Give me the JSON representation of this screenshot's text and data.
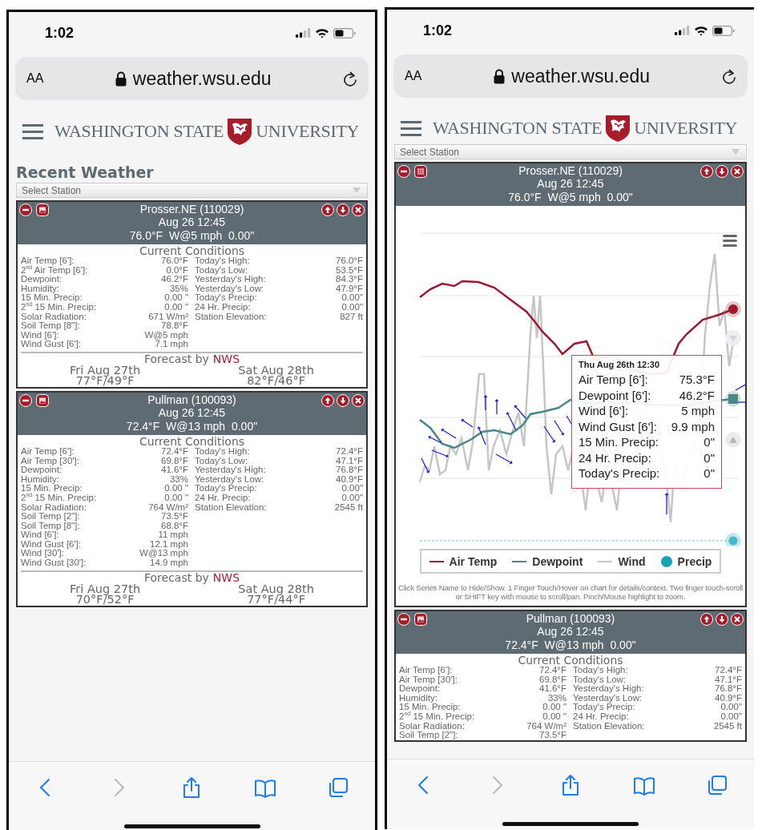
{
  "phones": [
    {
      "status": {
        "time": "1:02"
      },
      "address_bar": {
        "text_size_button": "AA",
        "url": "weather.wsu.edu"
      },
      "site_header": {
        "logo_left": "WASHINGTON STATE",
        "logo_right": "UNIVERSITY"
      },
      "page_title": "Recent Weather",
      "station_select": {
        "placeholder": "Select Station"
      },
      "stations": [
        {
          "kind": "conditions",
          "name": "Prosser.NE (110029)",
          "datetime": "Aug 26 12:45",
          "summary": "76.0°F  W@5 mph  0.00\"",
          "conditions_title": "Current Conditions",
          "left_rows": [
            {
              "label": "Air Temp [6']:",
              "value": "76.0°F"
            },
            {
              "label": "2$^{nd}$ Air Temp [6']:",
              "value": "0.0°F"
            },
            {
              "label": "Dewpoint:",
              "value": "46.2°F"
            },
            {
              "label": "Humidity:",
              "value": "35%"
            },
            {
              "label": "15 Min. Precip:",
              "value": "0.00 \""
            },
            {
              "label": "2$^{nd}$ 15 Min. Precip:",
              "value": "0.00 \""
            },
            {
              "label": "Solar Radiation:",
              "value": "671 W/m²"
            },
            {
              "label": "Soil Temp [8\"]:",
              "value": "78.8°F"
            },
            {
              "label": "Wind [6']:",
              "value": "W@5 mph"
            },
            {
              "label": "Wind Gust [6']:",
              "value": "7.1 mph"
            }
          ],
          "right_rows": [
            {
              "label": "Today's High:",
              "value": "76.0°F"
            },
            {
              "label": "Today's Low:",
              "value": "53.5°F"
            },
            {
              "label": "Yesterday's High:",
              "value": "84.3°F"
            },
            {
              "label": "Yesterday's Low:",
              "value": "47.9°F"
            },
            {
              "label": "Today's Precip:",
              "value": "0.00\""
            },
            {
              "label": "24 Hr. Precip:",
              "value": "0.00\""
            },
            {
              "label": "Station Elevation:",
              "value": "827 ft"
            }
          ],
          "forecast": {
            "label": "Forecast by",
            "source": "NWS",
            "days": [
              {
                "day": "Fri Aug 27th",
                "temps": "77°F/49°F"
              },
              {
                "day": "Sat Aug 28th",
                "temps": "82°F/46°F"
              }
            ]
          }
        },
        {
          "kind": "conditions",
          "name": "Pullman (100093)",
          "datetime": "Aug 26 12:45",
          "summary": "72.4°F  W@13 mph  0.00\"",
          "conditions_title": "Current Conditions",
          "left_rows": [
            {
              "label": "Air Temp [6']:",
              "value": "72.4°F"
            },
            {
              "label": "Air Temp [30']:",
              "value": "69.8°F"
            },
            {
              "label": "Dewpoint:",
              "value": "41.6°F"
            },
            {
              "label": "Humidity:",
              "value": "33%"
            },
            {
              "label": "15 Min. Precip:",
              "value": "0.00 \""
            },
            {
              "label": "2$^{nd}$ 15 Min. Precip:",
              "value": "0.00 \""
            },
            {
              "label": "Solar Radiation:",
              "value": "764 W/m²"
            },
            {
              "label": "Soil Temp [2\"]:",
              "value": "73.5°F"
            },
            {
              "label": "Soil Temp [8\"]:",
              "value": "68.8°F"
            },
            {
              "label": "Wind [6']:",
              "value": "11 mph"
            },
            {
              "label": "Wind Gust [6']:",
              "value": "12.1 mph"
            },
            {
              "label": "Wind [30']:",
              "value": "W@13 mph"
            },
            {
              "label": "Wind Gust [30']:",
              "value": "14.9 mph"
            }
          ],
          "right_rows": [
            {
              "label": "Today's High:",
              "value": "72.4°F"
            },
            {
              "label": "Today's Low:",
              "value": "47.1°F"
            },
            {
              "label": "Yesterday's High:",
              "value": "76.8°F"
            },
            {
              "label": "Yesterday's Low:",
              "value": "40.9°F"
            },
            {
              "label": "Today's Precip:",
              "value": "0.00\""
            },
            {
              "label": "24 Hr. Precip:",
              "value": "0.00\""
            },
            {
              "label": "Station Elevation:",
              "value": "2545 ft"
            }
          ],
          "forecast": {
            "label": "Forecast by",
            "source": "NWS",
            "days": [
              {
                "day": "Fri Aug 27th",
                "temps": "70°F/52°F"
              },
              {
                "day": "Sat Aug 28th",
                "temps": "77°F/44°F"
              }
            ]
          }
        }
      ],
      "toolbar": [
        {
          "kind": "back",
          "disabled": false
        },
        {
          "kind": "forward",
          "disabled": true
        },
        {
          "kind": "share",
          "disabled": false
        },
        {
          "kind": "bookmarks",
          "disabled": false
        },
        {
          "kind": "tabs",
          "disabled": false
        }
      ]
    },
    {
      "status": {
        "time": "1:02"
      },
      "address_bar": {
        "text_size_button": "AA",
        "url": "weather.wsu.edu"
      },
      "site_header": {
        "logo_left": "WASHINGTON STATE",
        "logo_right": "UNIVERSITY"
      },
      "station_select": {
        "placeholder": "Select Station"
      },
      "stations": [
        {
          "kind": "chart",
          "name": "Prosser.NE (110029)",
          "datetime": "Aug 26 12:45",
          "summary": "76.0°F  W@5 mph  0.00\"",
          "chart": {
            "tooltip": {
              "title": "Thu Aug 26th 12:30",
              "rows": [
                {
                  "label": "Air Temp [6']:",
                  "value": "75.3°F"
                },
                {
                  "label": "Dewpoint [6']:",
                  "value": "46.2°F"
                },
                {
                  "label": "Wind [6']:",
                  "value": "5 mph"
                },
                {
                  "label": "Wind Gust [6']:",
                  "value": "9.9 mph"
                },
                {
                  "label": "15 Min. Precip:",
                  "value": "0\""
                },
                {
                  "label": "24 Hr. Precip:",
                  "value": "0\""
                },
                {
                  "label": "Today's Precip:",
                  "value": "0\""
                }
              ]
            },
            "legend": [
              {
                "label": "Air Temp",
                "color": "#9b1b30",
                "kind": "line"
              },
              {
                "label": "Dewpoint",
                "color": "#4a8785",
                "kind": "line"
              },
              {
                "label": "Wind",
                "color": "#c4c6c9",
                "kind": "line"
              },
              {
                "label": "Precip",
                "color": "#17a2b8",
                "kind": "dot"
              }
            ],
            "help": "Click Series Name to Hide/Show. 1 Finger Touch/Hover on chart for details/context. Two finger touch-scroll or SHIFT key with mouse to scroll/pan. Pinch/Mouse highlight to zoom."
          }
        },
        {
          "kind": "conditions",
          "name": "Pullman (100093)",
          "datetime": "Aug 26 12:45",
          "summary": "72.4°F  W@13 mph  0.00\"",
          "conditions_title": "Current Conditions",
          "left_rows": [
            {
              "label": "Air Temp [6']:",
              "value": "72.4°F"
            },
            {
              "label": "Air Temp [30']:",
              "value": "69.8°F"
            },
            {
              "label": "Dewpoint:",
              "value": "41.6°F"
            },
            {
              "label": "Humidity:",
              "value": "33%"
            },
            {
              "label": "15 Min. Precip:",
              "value": "0.00 \""
            },
            {
              "label": "2$^{nd}$ 15 Min. Precip:",
              "value": "0.00 \""
            },
            {
              "label": "Solar Radiation:",
              "value": "764 W/m²"
            },
            {
              "label": "Soil Temp [2\"]:",
              "value": "73.5°F"
            }
          ],
          "right_rows": [
            {
              "label": "Today's High:",
              "value": "72.4°F"
            },
            {
              "label": "Today's Low:",
              "value": "47.1°F"
            },
            {
              "label": "Yesterday's High:",
              "value": "76.8°F"
            },
            {
              "label": "Yesterday's Low:",
              "value": "40.9°F"
            },
            {
              "label": "Today's Precip:",
              "value": "0.00\""
            },
            {
              "label": "24 Hr. Precip:",
              "value": "0.00\""
            },
            {
              "label": "Station Elevation:",
              "value": "2545 ft"
            }
          ]
        }
      ],
      "toolbar": [
        {
          "kind": "back",
          "disabled": false
        },
        {
          "kind": "forward",
          "disabled": true
        },
        {
          "kind": "share",
          "disabled": false
        },
        {
          "kind": "bookmarks",
          "disabled": false
        },
        {
          "kind": "tabs",
          "disabled": false
        }
      ]
    }
  ]
}
